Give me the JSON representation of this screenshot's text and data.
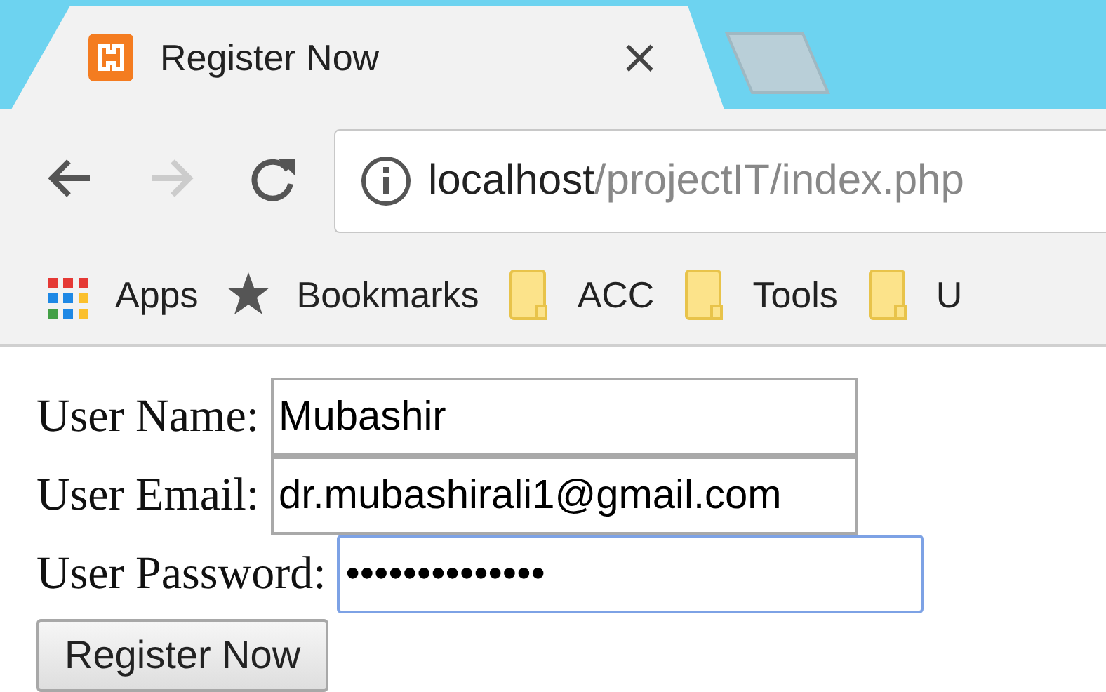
{
  "tab": {
    "title": "Register Now",
    "close": "×",
    "selected": true
  },
  "address": {
    "host": "localhost",
    "path": "/projectIT/index.php"
  },
  "bookmarks": [
    {
      "kind": "apps",
      "label": "Apps"
    },
    {
      "kind": "star",
      "label": "Bookmarks"
    },
    {
      "kind": "folder",
      "label": "ACC"
    },
    {
      "kind": "folder",
      "label": "Tools"
    },
    {
      "kind": "folder",
      "label": "U"
    }
  ],
  "form": {
    "fields": [
      {
        "label": "User Name:",
        "value": "Mubashir",
        "focused": false
      },
      {
        "label": "User Email:",
        "value": "dr.mubashirali1@gmail.com",
        "focused": false
      },
      {
        "label": "User Password:",
        "value": "••••••••••••••",
        "focused": true
      }
    ],
    "button": "Register Now"
  }
}
